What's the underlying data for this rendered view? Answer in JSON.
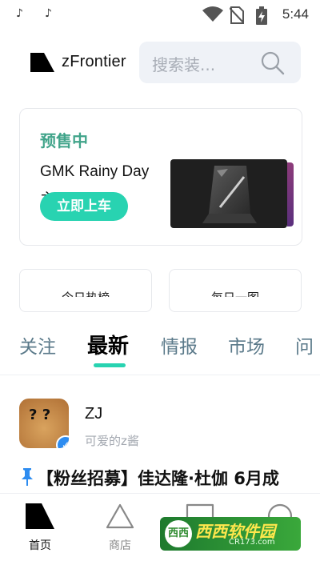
{
  "status_bar": {
    "time": "5:44",
    "icons": [
      "tiktok-icon",
      "tiktok-icon",
      "wifi-icon",
      "no-sim-icon",
      "battery-charging-icon"
    ]
  },
  "header": {
    "logo_text": "zFrontier",
    "search_placeholder": "搜索装...",
    "icons": [
      "search-icon"
    ]
  },
  "promo": {
    "tag": "预售中",
    "title": "GMK Rainy Day",
    "subtitle": "主题...",
    "cta_label": "立即上车",
    "accent_color": "#28d3b1",
    "tag_color": "#41a48a"
  },
  "subcards": [
    {
      "label": "今日热榜"
    },
    {
      "label": "每日一图"
    }
  ],
  "tabs": [
    {
      "label": "关注",
      "active": false
    },
    {
      "label": "最新",
      "active": true
    },
    {
      "label": "情报",
      "active": false
    },
    {
      "label": "市场",
      "active": false
    },
    {
      "label": "问",
      "active": false
    }
  ],
  "post": {
    "author": "ZJ",
    "author_subtitle": "可爱的z酱",
    "avatar_text": "? ?",
    "title": "【粉丝招募】佳达隆·杜伽 6月成",
    "icons": [
      "pin-icon",
      "verified-icon"
    ]
  },
  "bottom_nav": [
    {
      "label": "首页",
      "icon": "home-icon",
      "active": true
    },
    {
      "label": "商店",
      "icon": "shop-icon",
      "active": false
    },
    {
      "label": "",
      "icon": "message-icon",
      "active": false
    },
    {
      "label": "",
      "icon": "profile-icon",
      "active": false
    }
  ],
  "watermark": {
    "title": "西西软件园",
    "url": "CR173.com",
    "logo_text": "西西"
  }
}
